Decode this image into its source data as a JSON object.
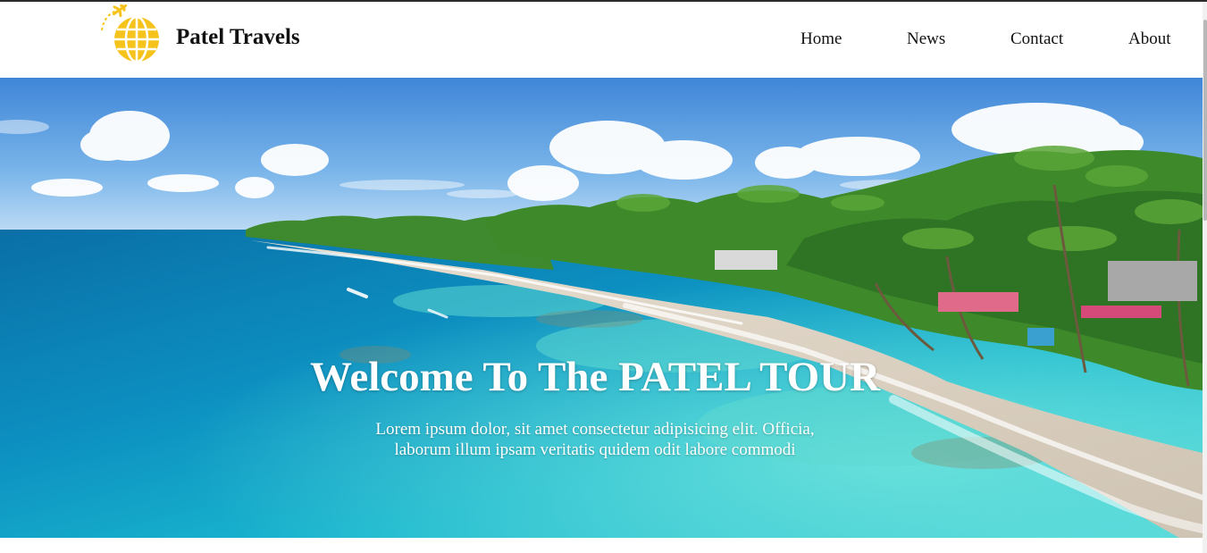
{
  "header": {
    "brand": "Patel Travels",
    "logo_icon": "globe-with-airplane-icon",
    "accent_color": "#f6c31c"
  },
  "nav": {
    "items": [
      {
        "label": "Home"
      },
      {
        "label": "News"
      },
      {
        "label": "Contact"
      },
      {
        "label": "About"
      }
    ]
  },
  "hero": {
    "title": "Welcome To The PATEL TOUR",
    "subtitle": "Lorem ipsum dolor, sit amet consectetur adipisicing elit. Officia, laborum illum ipsam veritatis quidem odit labore commodi",
    "background": "tropical-beach-with-palm-trees"
  }
}
